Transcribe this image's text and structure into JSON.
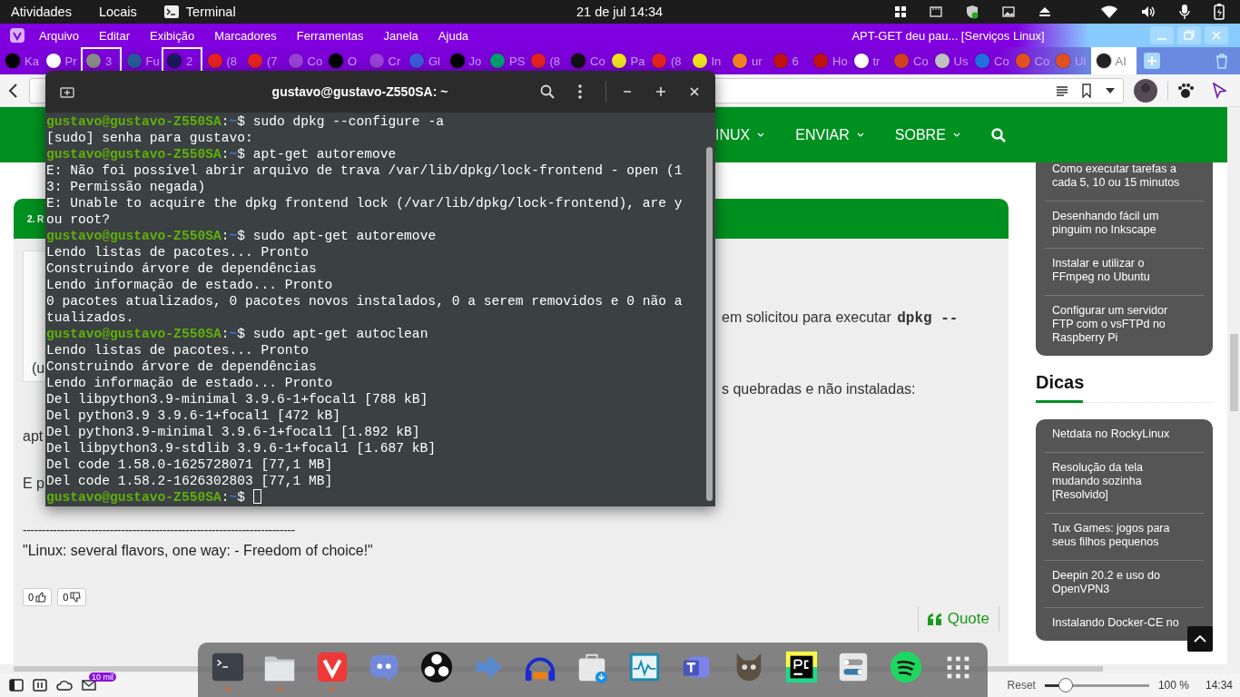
{
  "top_bar": {
    "activities": "Atividades",
    "places": "Locais",
    "app": "Terminal",
    "clock": "21 de jul  14:34"
  },
  "browser": {
    "menu": [
      "Arquivo",
      "Editar",
      "Exibição",
      "Marcadores",
      "Ferramentas",
      "Janela",
      "Ajuda"
    ],
    "title": "APT-GET deu pau... [Serviços Linux]",
    "tabs": [
      {
        "label": "Ka",
        "color": "#000000",
        "stacked": false,
        "selected": false
      },
      {
        "label": "Pr",
        "color": "#ffffff",
        "stacked": false,
        "selected": false
      },
      {
        "label": "3",
        "color": "#8a8a8a",
        "stacked": true,
        "selected": false
      },
      {
        "label": "Fu",
        "color": "#2a5a9a",
        "stacked": false,
        "selected": false
      },
      {
        "label": "2",
        "color": "#1a1a5a",
        "stacked": true,
        "selected": false
      },
      {
        "label": "(8",
        "color": "#e52222",
        "stacked": false,
        "selected": false
      },
      {
        "label": "(7",
        "color": "#e52222",
        "stacked": false,
        "selected": false
      },
      {
        "label": "Co",
        "color": "#9a40d8",
        "stacked": false,
        "selected": false
      },
      {
        "label": "O",
        "color": "#000000",
        "stacked": false,
        "selected": false
      },
      {
        "label": "Cr",
        "color": "#9a40d8",
        "stacked": false,
        "selected": false
      },
      {
        "label": "Gl",
        "color": "#3b5bdb",
        "stacked": false,
        "selected": false
      },
      {
        "label": "Jo",
        "color": "#000000",
        "stacked": false,
        "selected": false
      },
      {
        "label": "PS",
        "color": "#00a070",
        "stacked": false,
        "selected": false
      },
      {
        "label": "(8",
        "color": "#e52222",
        "stacked": false,
        "selected": false
      },
      {
        "label": "Co",
        "color": "#111111",
        "stacked": false,
        "selected": false
      },
      {
        "label": "Pa",
        "color": "#f0e020",
        "stacked": false,
        "selected": false
      },
      {
        "label": "(8",
        "color": "#e52222",
        "stacked": false,
        "selected": false
      },
      {
        "label": "In",
        "color": "#f0e020",
        "stacked": false,
        "selected": false
      },
      {
        "label": "ur",
        "color": "#f08020",
        "stacked": false,
        "selected": false
      },
      {
        "label": "6",
        "color": "#c01010",
        "stacked": false,
        "selected": false
      },
      {
        "label": "Ho",
        "color": "#c01010",
        "stacked": false,
        "selected": false
      },
      {
        "label": "tr",
        "color": "#ffffff",
        "stacked": false,
        "selected": false
      },
      {
        "label": "Co",
        "color": "#d04020",
        "stacked": false,
        "selected": false
      },
      {
        "label": "Us",
        "color": "#c0c0c0",
        "stacked": false,
        "selected": false
      },
      {
        "label": "Co",
        "color": "#2070e0",
        "stacked": false,
        "selected": false
      },
      {
        "label": "Co",
        "color": "#e05020",
        "stacked": false,
        "selected": false
      },
      {
        "label": "Ul",
        "color": "#e05020",
        "stacked": false,
        "selected": false
      },
      {
        "label": "AI",
        "color": "#222222",
        "stacked": false,
        "selected": true
      }
    ]
  },
  "page": {
    "nav": [
      {
        "label": "INUX",
        "dropdown": true
      },
      {
        "label": "ENVIAR",
        "dropdown": true
      },
      {
        "label": "SOBRE",
        "dropdown": true
      }
    ],
    "post_header": "2. R",
    "author_fragment": "(u",
    "body_right": [
      {
        "text": "em solicitou para executar ",
        "code": "dpkg --"
      },
      {
        "text": "s quebradas e não instaladas:"
      }
    ],
    "body_left": [
      "apt",
      "E p"
    ],
    "divider": "------------------------------------------------------------------------",
    "signature": "\"Linux: several flavors, one way: - Freedom of choice!\"",
    "likes": "0",
    "dislikes": "0",
    "quote": "Quote",
    "sidebar": [
      {
        "items": [
          "Como executar tarefas a cada 5, 10 ou 15 minutos",
          "Desenhando fácil um pinguim no Inkscape",
          "Instalar e utilizar o FFmpeg no Ubuntu",
          "Configurar um servidor FTP com o vsFTPd no Raspberry Pi"
        ]
      },
      {
        "heading": "Dicas",
        "items": [
          "Netdata no RockyLinux",
          "Resolução da tela mudando sozinha [Resolvido]",
          "Tux Games: jogos para seus filhos pequenos",
          "Deepin 20.2 e uso do OpenVPN3",
          "Instalando Docker-CE no"
        ]
      }
    ]
  },
  "status_bar": {
    "mail_badge": "10 mil",
    "reset": "Reset",
    "zoom": {
      "level": 0.2
    },
    "zoom_reading": "100 %",
    "clock": "14:34"
  },
  "terminal": {
    "title": "gustavo@gustavo-Z550SA: ~",
    "lines": [
      {
        "kind": "prompt",
        "user": "gustavo@gustavo-Z550SA",
        "sep": ":",
        "path": "~",
        "symbol": "$",
        "command": "sudo dpkg --configure -a"
      },
      {
        "kind": "output",
        "text": "[sudo] senha para gustavo:"
      },
      {
        "kind": "prompt",
        "user": "gustavo@gustavo-Z550SA",
        "sep": ":",
        "path": "~",
        "symbol": "$",
        "command": "apt-get autoremove"
      },
      {
        "kind": "output",
        "text": "E: Não foi possível abrir arquivo de trava /var/lib/dpkg/lock-frontend - open (1"
      },
      {
        "kind": "output",
        "text": "3: Permissão negada)"
      },
      {
        "kind": "output",
        "text": "E: Unable to acquire the dpkg frontend lock (/var/lib/dpkg/lock-frontend), are y"
      },
      {
        "kind": "output",
        "text": "ou root?"
      },
      {
        "kind": "prompt",
        "user": "gustavo@gustavo-Z550SA",
        "sep": ":",
        "path": "~",
        "symbol": "$",
        "command": "sudo apt-get autoremove"
      },
      {
        "kind": "output",
        "text": "Lendo listas de pacotes... Pronto"
      },
      {
        "kind": "output",
        "text": "Construindo árvore de dependências"
      },
      {
        "kind": "output",
        "text": "Lendo informação de estado... Pronto"
      },
      {
        "kind": "output",
        "text": "0 pacotes atualizados, 0 pacotes novos instalados, 0 a serem removidos e 0 não a"
      },
      {
        "kind": "output",
        "text": "tualizados."
      },
      {
        "kind": "prompt",
        "user": "gustavo@gustavo-Z550SA",
        "sep": ":",
        "path": "~",
        "symbol": "$",
        "command": "sudo apt-get autoclean"
      },
      {
        "kind": "output",
        "text": "Lendo listas de pacotes... Pronto"
      },
      {
        "kind": "output",
        "text": "Construindo árvore de dependências"
      },
      {
        "kind": "output",
        "text": "Lendo informação de estado... Pronto"
      },
      {
        "kind": "output",
        "text": "Del libpython3.9-minimal 3.9.6-1+focal1 [788 kB]"
      },
      {
        "kind": "output",
        "text": "Del python3.9 3.9.6-1+focal1 [472 kB]"
      },
      {
        "kind": "output",
        "text": "Del python3.9-minimal 3.9.6-1+focal1 [1.892 kB]"
      },
      {
        "kind": "output",
        "text": "Del libpython3.9-stdlib 3.9.6-1+focal1 [1.687 kB]"
      },
      {
        "kind": "output",
        "text": "Del code 1.58.0-1625728071 [77,1 MB]"
      },
      {
        "kind": "output",
        "text": "Del code 1.58.2-1626302803 [77,1 MB]"
      },
      {
        "kind": "prompt",
        "user": "gustavo@gustavo-Z550SA",
        "sep": ":",
        "path": "~",
        "symbol": "$",
        "cursor": true
      }
    ]
  },
  "dock": [
    {
      "kind": "terminal",
      "running": true
    },
    {
      "kind": "folder",
      "running": true
    },
    {
      "kind": "vivaldi",
      "running": true
    },
    {
      "kind": "discord",
      "running": false
    },
    {
      "kind": "obs",
      "running": false
    },
    {
      "kind": "arrow",
      "running": false
    },
    {
      "kind": "headphones",
      "running": false
    },
    {
      "kind": "store",
      "running": false
    },
    {
      "kind": "monitor",
      "running": false
    },
    {
      "kind": "teams",
      "running": false
    },
    {
      "kind": "gimp",
      "running": false
    },
    {
      "kind": "pycharm",
      "running": false
    },
    {
      "kind": "toggles",
      "running": false
    },
    {
      "kind": "spotify",
      "running": false
    },
    {
      "kind": "grid",
      "running": false
    }
  ]
}
